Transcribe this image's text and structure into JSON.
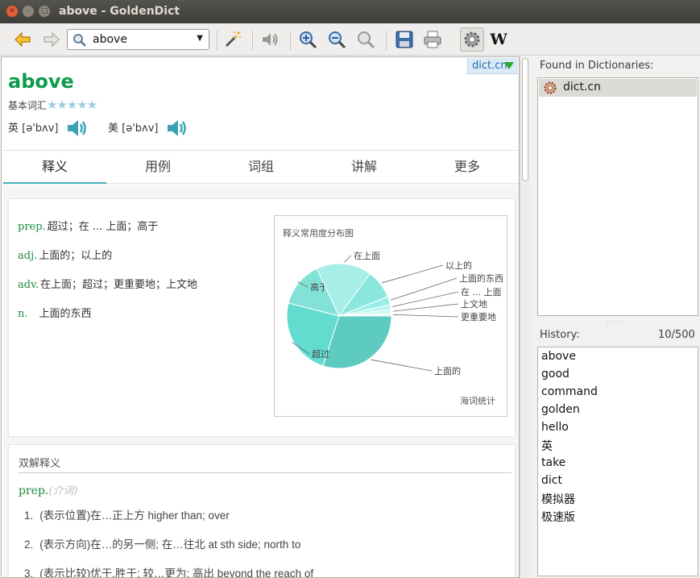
{
  "window": {
    "title": "above - GoldenDict"
  },
  "toolbar": {
    "search_value": "above",
    "icons": [
      "back-arrow-icon",
      "forward-arrow-icon",
      "magic-wand-icon",
      "speaker-icon",
      "zoom-in-icon",
      "zoom-out-icon",
      "zoom-reset-icon",
      "save-icon",
      "print-icon",
      "settings-icon",
      "wikipedia-icon"
    ],
    "wiki_label": "W"
  },
  "article": {
    "dict_badge": "dict.cn",
    "headword": "above",
    "level_label": "基本词汇",
    "stars": "★★★★★",
    "uk_label": "英 [ə'bʌv]",
    "us_label": "美 [ə'bʌv]",
    "tabs": [
      "释义",
      "用例",
      "词组",
      "讲解",
      "更多"
    ],
    "definitions": [
      {
        "pos": "prep.",
        "text": "超过；在 ... 上面；高于"
      },
      {
        "pos": "adj.",
        "text": "上面的；以上的"
      },
      {
        "pos": "adv.",
        "text": "在上面；超过；更重要地；上文地"
      },
      {
        "pos": "n.",
        "text": "上面的东西"
      }
    ],
    "bilingual": {
      "heading": "双解释义",
      "pos": "prep.",
      "pos_note": "(介词)",
      "senses": [
        {
          "n": "1.",
          "text": "(表示位置)在…正上方 higher than; over"
        },
        {
          "n": "2.",
          "text": "(表示方向)在…的另一侧; 在…往北 at sth side; north to"
        },
        {
          "n": "3.",
          "text": "(表示比较)优于,胜于; 较…更为; 高出 beyond the reach of"
        }
      ]
    }
  },
  "chart_data": {
    "type": "pie",
    "title": "释义常用度分布图",
    "source": "海词统计",
    "categories": [
      "上面的",
      "超过",
      "高于",
      "在上面",
      "以上的",
      "上面的东西",
      "在 ... 上面",
      "上文地",
      "更重要地"
    ],
    "values": [
      30,
      24,
      14,
      17,
      9,
      2.5,
      1.5,
      1.2,
      0.8
    ],
    "colors": [
      "#5ecbc0",
      "#62dccf",
      "#83e2d7",
      "#a6eee7",
      "#8be7dd",
      "#9aeee5",
      "#b7f4ee",
      "#cdf8f3",
      "#e3fbf8"
    ]
  },
  "right_panel": {
    "found_label": "Found in Dictionaries:",
    "found_items": [
      "dict.cn"
    ],
    "history_label": "History:",
    "history_count": "10/500",
    "history": [
      "above",
      "good",
      "command",
      "golden",
      "hello",
      "英",
      "take",
      "dict",
      "模拟器",
      "极速版"
    ]
  }
}
